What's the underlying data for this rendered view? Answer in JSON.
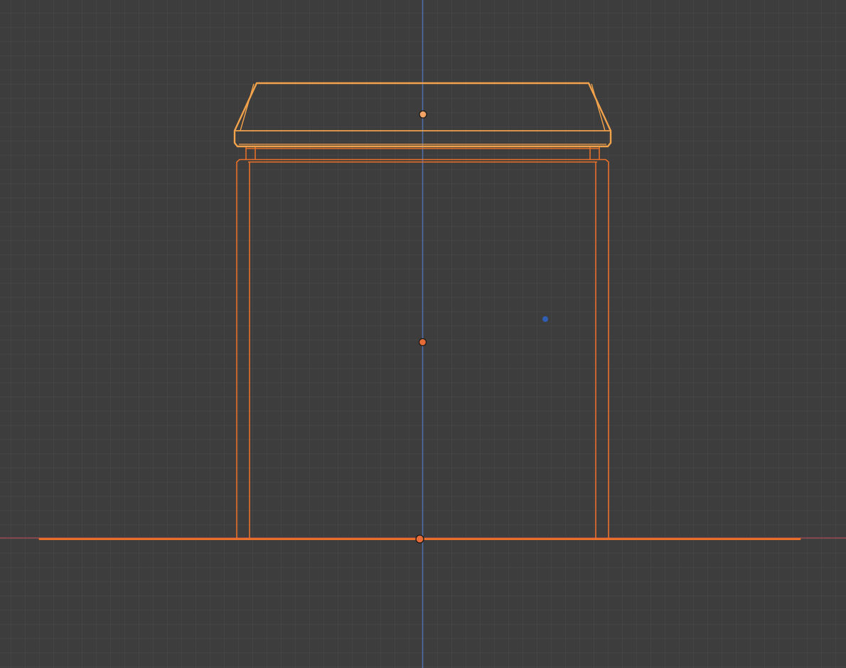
{
  "viewport": {
    "view": "front-orthographic",
    "grid_visible": true,
    "colors": {
      "background": "#3d3d3d",
      "grid_minor": "#4a4a4a",
      "grid_major": "#535353",
      "axis_z": "#4f6fa8",
      "axis_x": "#9a4b55",
      "selected_active": "#f2a24a",
      "selected": "#e8702a",
      "origin_active": "#f3a266",
      "origin": "#e46a38",
      "light_dot": "#2f5fb3"
    },
    "objects": [
      {
        "name": "cap",
        "selected": true,
        "active": true
      },
      {
        "name": "body",
        "selected": true,
        "active": false
      },
      {
        "name": "ground-plane",
        "selected": true,
        "active": false
      }
    ]
  }
}
